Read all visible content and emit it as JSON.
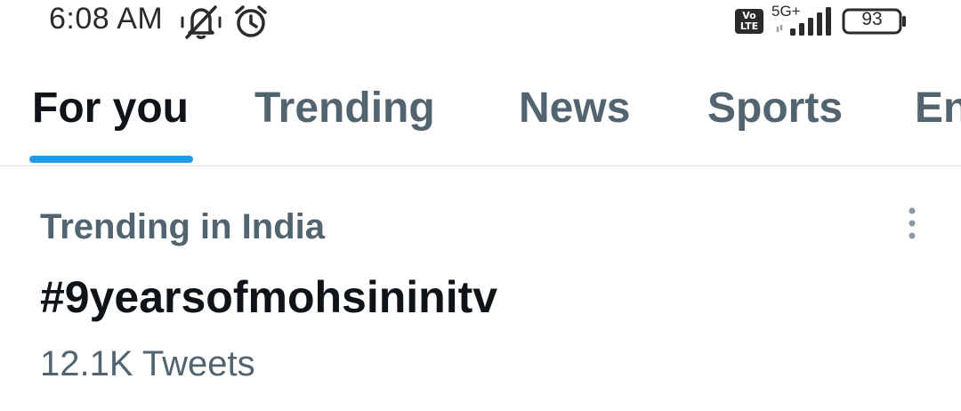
{
  "status_bar": {
    "time": "6:08 AM",
    "volte_label_top": "Vo",
    "volte_label_bottom": "LTE",
    "network_type": "5G+",
    "battery_level": "93",
    "icons": [
      "mute-icon",
      "alarm-icon",
      "volte-icon",
      "signal-icon",
      "battery-icon"
    ]
  },
  "tabs": [
    {
      "label": "For you",
      "active": true
    },
    {
      "label": "Trending",
      "active": false
    },
    {
      "label": "News",
      "active": false
    },
    {
      "label": "Sports",
      "active": false
    },
    {
      "label": "En",
      "active": false
    }
  ],
  "trend": {
    "context": "Trending in India",
    "title": "#9yearsofmohsininitv",
    "count": "12.1K Tweets",
    "menu_icon": "more-vertical-icon"
  },
  "colors": {
    "accent": "#1d9bf0",
    "primary_text": "#0f1419",
    "secondary_text": "#536471",
    "divider": "#d9dde0"
  }
}
